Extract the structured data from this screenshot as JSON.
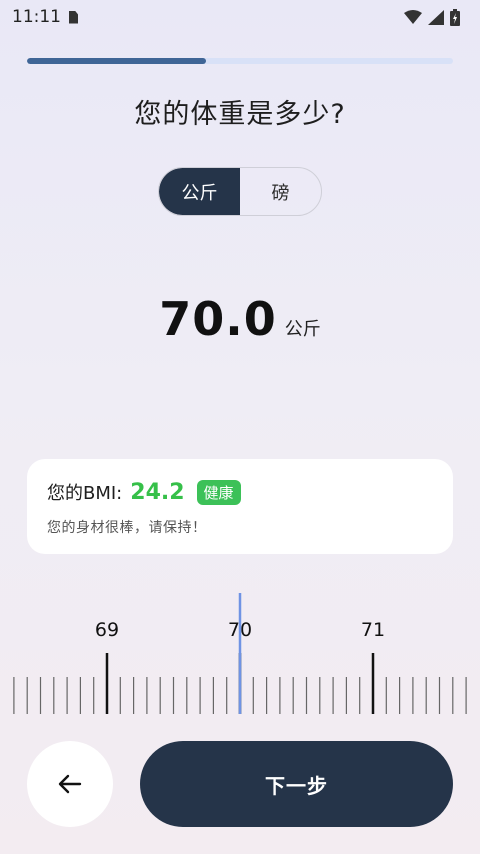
{
  "status_bar": {
    "time": "11:11",
    "icons": [
      "sim-card-icon",
      "wifi-icon",
      "signal-icon",
      "battery-icon"
    ]
  },
  "progress": {
    "value": 0.42
  },
  "question": {
    "title": "您的体重是多少?"
  },
  "unit_toggle": {
    "options": [
      {
        "label": "公斤",
        "selected": true
      },
      {
        "label": "磅",
        "selected": false
      }
    ]
  },
  "weight": {
    "value": "70.0",
    "unit": "公斤"
  },
  "bmi": {
    "label": "您的BMI:",
    "value": "24.2",
    "status": "健康",
    "message": "您的身材很棒，请保持！",
    "color_value": "#36c049",
    "color_badge": "#3cc158"
  },
  "ruler": {
    "major_labels": [
      "69",
      "70",
      "71"
    ],
    "current_value": 70.0,
    "indicator_color": "#6f93e4"
  },
  "nav": {
    "back_icon": "arrow-left-icon",
    "next_label": "下一步"
  },
  "colors": {
    "primary_dark": "#253449",
    "progress_fill": "#3f6596",
    "progress_track": "#d8e1f7"
  }
}
